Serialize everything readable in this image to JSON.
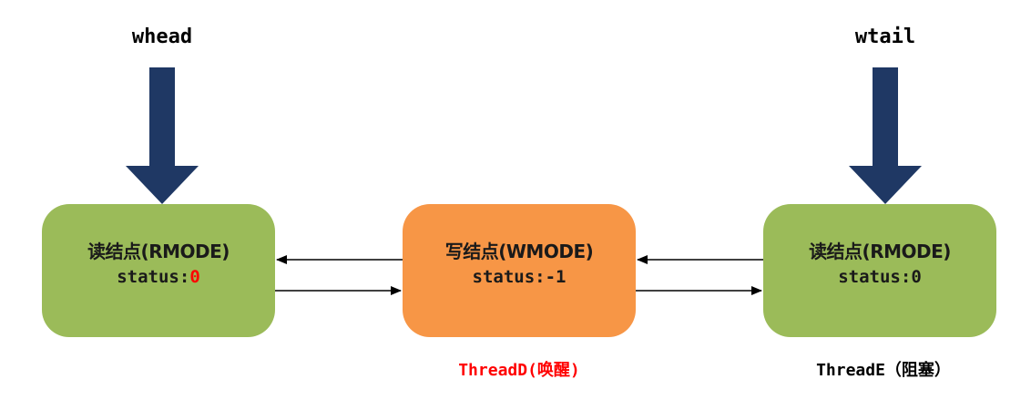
{
  "pointers": {
    "whead": "whead",
    "wtail": "wtail"
  },
  "nodes": {
    "left": {
      "title": "读结点(RMODE)",
      "status_prefix": "status:",
      "status_value": "0"
    },
    "center": {
      "title": "写结点(WMODE)",
      "status_prefix": "status:",
      "status_value": "-1"
    },
    "right": {
      "title": "读结点(RMODE)",
      "status_prefix": "status:",
      "status_value": "0"
    }
  },
  "threads": {
    "center": "ThreadD(唤醒)",
    "right": "ThreadE（阻塞）"
  },
  "colors": {
    "read_node": "#9bbb59",
    "write_node": "#f79646",
    "pointer_arrow": "#1f3864",
    "highlight_text": "#ff0000"
  }
}
